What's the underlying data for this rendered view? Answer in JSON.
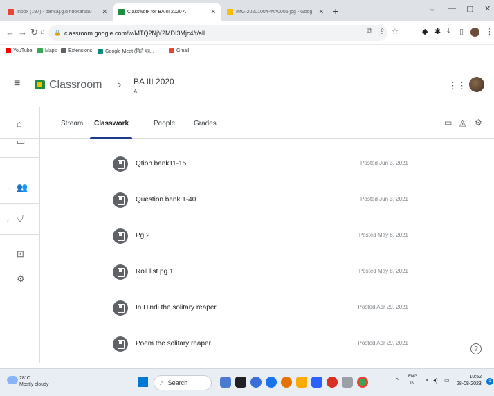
{
  "browser": {
    "tabs": [
      {
        "label": "Inbox (197) - pankaj.g.dindokar550",
        "favicon_color": "#ea4335",
        "active": false
      },
      {
        "label": "Classwork for BA III 2020 A",
        "favicon_color": "#1e8e3e",
        "active": true
      },
      {
        "label": "IMG-20201004-WA0005.jpg - Goog",
        "favicon_color": "#fbbc04",
        "active": false
      }
    ],
    "url": "classroom.google.com/w/MTQ2NjY2MDI3Mjc4/t/all",
    "bookmarks": [
      {
        "label": "YouTube",
        "color": "#ff0000"
      },
      {
        "label": "Maps",
        "color": "#34a853"
      },
      {
        "label": "Extensions",
        "color": "#5f6368"
      },
      {
        "label": "Google Meet (मिलें यह...",
        "color": "#00897b"
      },
      {
        "label": "Gmail",
        "color": "#ea4335"
      }
    ]
  },
  "app": {
    "name": "Classroom",
    "class_name": "BA III 2020",
    "class_section": "A"
  },
  "class_tabs": [
    "Stream",
    "Classwork",
    "People",
    "Grades"
  ],
  "active_tab": "Classwork",
  "classwork_items": [
    {
      "title": "Qtion bank11-15",
      "date": "Posted Jun 3, 2021"
    },
    {
      "title": "Question bank 1-40",
      "date": "Posted Jun 3, 2021"
    },
    {
      "title": "Pg 2",
      "date": "Posted May 8, 2021"
    },
    {
      "title": "Roll list pg 1",
      "date": "Posted May 8, 2021"
    },
    {
      "title": "In Hindi the solitary reaper",
      "date": "Posted Apr 29, 2021"
    },
    {
      "title": "Poem the solitary reaper.",
      "date": "Posted Apr 29, 2021"
    }
  ],
  "taskbar": {
    "weather_temp": "28°C",
    "weather_desc": "Mostly cloudy",
    "search_label": "Search",
    "lang_1": "ENG",
    "lang_2": "IN",
    "time": "10:52",
    "date": "28-08-2023",
    "notification_count": "1"
  }
}
